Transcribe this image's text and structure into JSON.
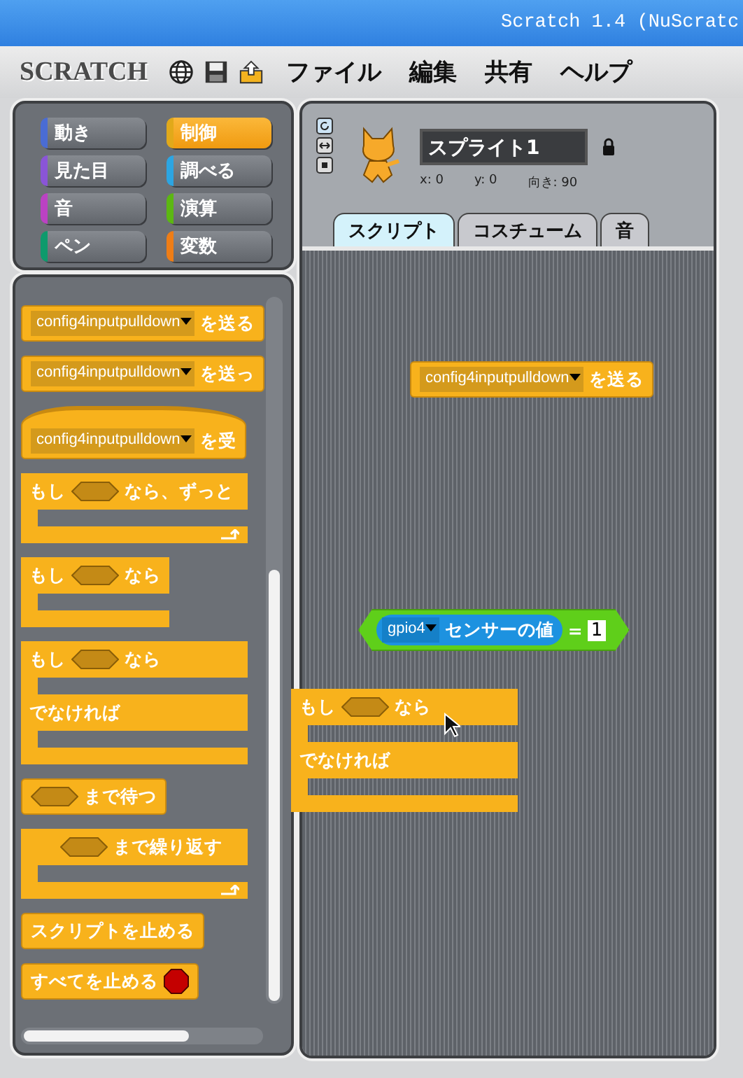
{
  "window": {
    "title": "Scratch 1.4 (NuScratc"
  },
  "menu": {
    "logo": "SCRATCH",
    "items": [
      "ファイル",
      "編集",
      "共有",
      "ヘルプ"
    ]
  },
  "categories": [
    {
      "label": "動き",
      "color": "#4a6cd4",
      "selected": false
    },
    {
      "label": "制御",
      "color": "#e1a91a",
      "selected": true
    },
    {
      "label": "見た目",
      "color": "#8a55d7",
      "selected": false
    },
    {
      "label": "調べる",
      "color": "#2ca5e2",
      "selected": false
    },
    {
      "label": "音",
      "color": "#bb42c3",
      "selected": false
    },
    {
      "label": "演算",
      "color": "#5cb712",
      "selected": false
    },
    {
      "label": "ペン",
      "color": "#0e9a6c",
      "selected": false
    },
    {
      "label": "変数",
      "color": "#ee7d16",
      "selected": false
    }
  ],
  "sprite": {
    "name": "スプライト1",
    "x": "x: 0",
    "y": "y: 0",
    "direction": "向き: 90"
  },
  "tabs": [
    {
      "label": "スクリプト",
      "selected": true
    },
    {
      "label": "コスチューム",
      "selected": false
    },
    {
      "label": "音",
      "selected": false
    }
  ],
  "palette": [
    {
      "kind": "stack",
      "parts": [
        {
          "kind": "menu",
          "text": "config4inputpulldown"
        },
        {
          "kind": "text",
          "text": "を送る"
        }
      ]
    },
    {
      "kind": "stack",
      "parts": [
        {
          "kind": "menu",
          "text": "config4inputpulldown"
        },
        {
          "kind": "text",
          "text": "を送っ"
        }
      ]
    },
    {
      "kind": "hat",
      "parts": [
        {
          "kind": "menu",
          "text": "config4inputpulldown"
        },
        {
          "kind": "text",
          "text": "を受"
        }
      ]
    },
    {
      "kind": "c_loop",
      "parts": [
        {
          "kind": "text",
          "text": "もし"
        },
        {
          "kind": "bool"
        },
        {
          "kind": "text",
          "text": "なら、ずっと"
        }
      ]
    },
    {
      "kind": "c",
      "parts": [
        {
          "kind": "text",
          "text": "もし"
        },
        {
          "kind": "bool"
        },
        {
          "kind": "text",
          "text": "なら"
        }
      ]
    },
    {
      "kind": "c_else",
      "parts": [
        {
          "kind": "text",
          "text": "もし"
        },
        {
          "kind": "bool"
        },
        {
          "kind": "text",
          "text": "なら"
        }
      ],
      "else": "でなければ"
    },
    {
      "kind": "stack",
      "parts": [
        {
          "kind": "bool"
        },
        {
          "kind": "text",
          "text": "まで待つ"
        }
      ]
    },
    {
      "kind": "c_loop",
      "parts": [
        {
          "kind": "bool"
        },
        {
          "kind": "text",
          "text": "まで繰り返す"
        }
      ]
    },
    {
      "kind": "stack",
      "parts": [
        {
          "kind": "text",
          "text": "スクリプトを止める"
        }
      ]
    },
    {
      "kind": "stack",
      "parts": [
        {
          "kind": "text",
          "text": "すべてを止める"
        },
        {
          "kind": "stop"
        }
      ]
    }
  ],
  "scripts": [
    {
      "kind": "stack",
      "parts": [
        {
          "kind": "menu",
          "text": "config4inputpulldown"
        },
        {
          "kind": "text",
          "text": "を送る"
        }
      ]
    },
    {
      "kind": "boolean",
      "parts": [
        {
          "kind": "reporter",
          "parts": [
            {
              "kind": "menu",
              "text": "gpio4"
            },
            {
              "kind": "text",
              "text": "センサーの値"
            }
          ]
        },
        {
          "kind": "text",
          "text": "="
        },
        {
          "kind": "field",
          "text": "1"
        }
      ]
    }
  ],
  "dragged_block": {
    "kind": "c_else",
    "parts": [
      {
        "kind": "text",
        "text": "もし"
      },
      {
        "kind": "bool"
      },
      {
        "kind": "text",
        "text": "なら"
      }
    ],
    "else": "でなければ"
  }
}
